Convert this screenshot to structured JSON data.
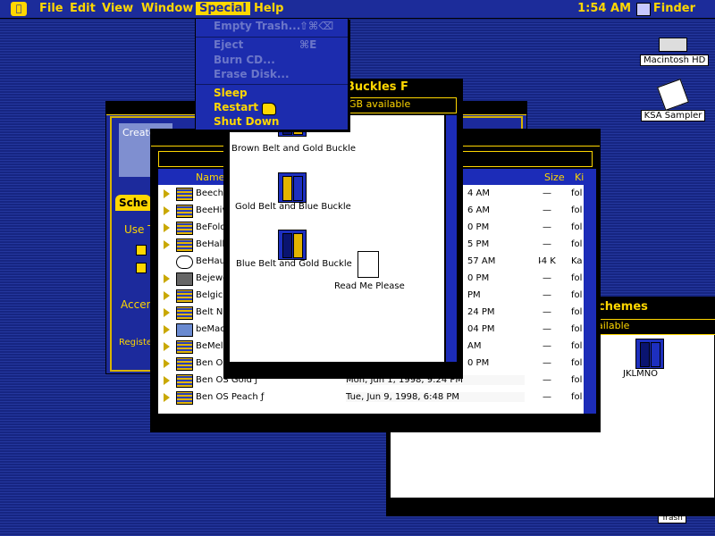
{
  "menubar": {
    "items": [
      "File",
      "Edit",
      "View",
      "Window",
      "Special",
      "Help"
    ],
    "clock": "1:54 AM",
    "app": "Finder"
  },
  "special_menu": {
    "empty_trash": "Empty Trash...",
    "empty_trash_shortcut": "⇧⌘⌫",
    "eject": "Eject",
    "eject_shortcut": "⌘E",
    "burn_cd": "Burn CD...",
    "erase_disk": "Erase Disk...",
    "sleep": "Sleep",
    "restart": "Restart",
    "shut_down": "Shut Down"
  },
  "desktop": {
    "icons": [
      "Macintosh HD",
      "KSA Sampler"
    ],
    "trash_partial": "Trash"
  },
  "buckles_window": {
    "title": "Buckles F",
    "info": "GB available",
    "items": [
      "Brown Belt and Gold Buckle",
      "Gold Belt and Blue Buckle",
      "Blue Belt and Gold Buckle",
      "Read Me Please"
    ]
  },
  "schemes_window": {
    "title": "chemes",
    "info": "ailable",
    "item": "JKLMNO"
  },
  "back_window": {
    "create": "Create",
    "sche": "Sche",
    "use": "Use T",
    "accent": "Accen",
    "register": "Register"
  },
  "list_window": {
    "col_name": "Name",
    "col_size": "Size",
    "col_kind": "Ki",
    "rows": [
      {
        "name": "Beech",
        "date": "4 AM",
        "size": "—",
        "kind": "fol"
      },
      {
        "name": "BeeHiv",
        "date": "6 AM",
        "size": "—",
        "kind": "fol"
      },
      {
        "name": "BeFolde",
        "date": "0 PM",
        "size": "—",
        "kind": "fol"
      },
      {
        "name": "BeHallo",
        "date": "5 PM",
        "size": "—",
        "kind": "fol"
      },
      {
        "name": "BeHaus",
        "date": "57 AM",
        "size": "144 K",
        "kind": "Ka"
      },
      {
        "name": "Bejewe",
        "date": "0 PM",
        "size": "—",
        "kind": "fol"
      },
      {
        "name": "Belgica",
        "date": "PM",
        "size": "—",
        "kind": "fol"
      },
      {
        "name": "Belt N",
        "date": "24 PM",
        "size": "—",
        "kind": "fol"
      },
      {
        "name": "beMac",
        "date": "04 PM",
        "size": "—",
        "kind": "fol"
      },
      {
        "name": "BeMela",
        "date": "AM",
        "size": "—",
        "kind": "fol"
      },
      {
        "name": "Ben OS",
        "date": "0 PM",
        "size": "—",
        "kind": "fol"
      },
      {
        "name": "Ben OS Gold ƒ",
        "date": "Mon, Jun 1, 1998, 9:24 PM",
        "size": "—",
        "kind": "fol"
      },
      {
        "name": "Ben OS Peach ƒ",
        "date": "Tue, Jun 9, 1998, 6:48 PM",
        "size": "—",
        "kind": "fol"
      }
    ]
  }
}
